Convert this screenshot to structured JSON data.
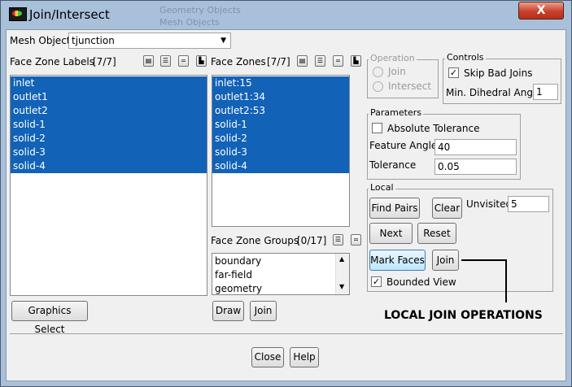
{
  "window": {
    "title": "Join/Intersect",
    "close_glyph": "X",
    "bg_labels": [
      "Geometry Objects",
      "Mesh Objects"
    ]
  },
  "mesh_object": {
    "label": "Mesh Object",
    "value": "tjunction"
  },
  "face_zone_labels": {
    "label": "Face Zone Labels",
    "count": "[7/7]",
    "items": [
      "inlet",
      "outlet1",
      "outlet2",
      "solid-1",
      "solid-2",
      "solid-3",
      "solid-4"
    ]
  },
  "face_zones": {
    "label": "Face Zones",
    "count": "[7/7]",
    "items": [
      "inlet:15",
      "outlet1:34",
      "outlet2:53",
      "solid-1",
      "solid-2",
      "solid-3",
      "solid-4"
    ]
  },
  "face_zone_groups": {
    "label": "Face Zone Groups",
    "count": "[0/17]",
    "items": [
      "boundary",
      "far-field",
      "geometry"
    ]
  },
  "operation": {
    "label": "Operation",
    "join": "Join",
    "intersect": "Intersect"
  },
  "controls": {
    "label": "Controls",
    "skip_bad_joins": "Skip Bad Joins",
    "min_dihedral_label": "Min. Dihedral Angle",
    "min_dihedral_value": "1"
  },
  "parameters": {
    "label": "Parameters",
    "absolute_tolerance": "Absolute Tolerance",
    "feature_angle_label": "Feature Angle",
    "feature_angle_value": "40",
    "tolerance_label": "Tolerance",
    "tolerance_value": "0.05"
  },
  "local": {
    "label": "Local",
    "find_pairs": "Find Pairs",
    "clear": "Clear",
    "unvisited_label": "Unvisited",
    "unvisited_value": "5",
    "next": "Next",
    "reset": "Reset",
    "mark_faces": "Mark Faces",
    "join": "Join",
    "bounded_view": "Bounded View"
  },
  "buttons": {
    "graphics_select": "Graphics Select",
    "draw": "Draw",
    "join": "Join",
    "close": "Close",
    "help": "Help"
  },
  "annotation": "LOCAL JOIN OPERATIONS"
}
